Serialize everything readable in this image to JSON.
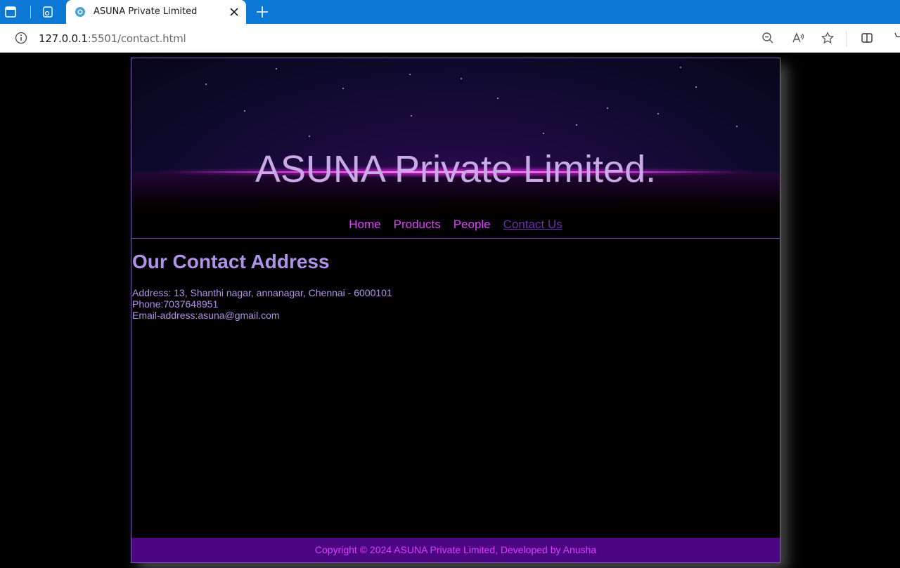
{
  "browser": {
    "tab_title": "ASUNA Private Limited",
    "url_host": "127.0.0.1",
    "url_rest": ":5501/contact.html"
  },
  "site": {
    "banner_title": "ASUNA Private Limited.",
    "nav": [
      {
        "label": "Home"
      },
      {
        "label": "Products"
      },
      {
        "label": "People"
      },
      {
        "label": "Contact Us"
      }
    ],
    "heading": "Our Contact Address",
    "address": "Address: 13, Shanthi nagar, annanagar, Chennai - 6000101",
    "phone": "Phone:7037648951",
    "email": "Email-address:asuna@gmail.com",
    "footer": "Copyright © 2024 ASUNA Private Limited, Developed by Anusha"
  }
}
